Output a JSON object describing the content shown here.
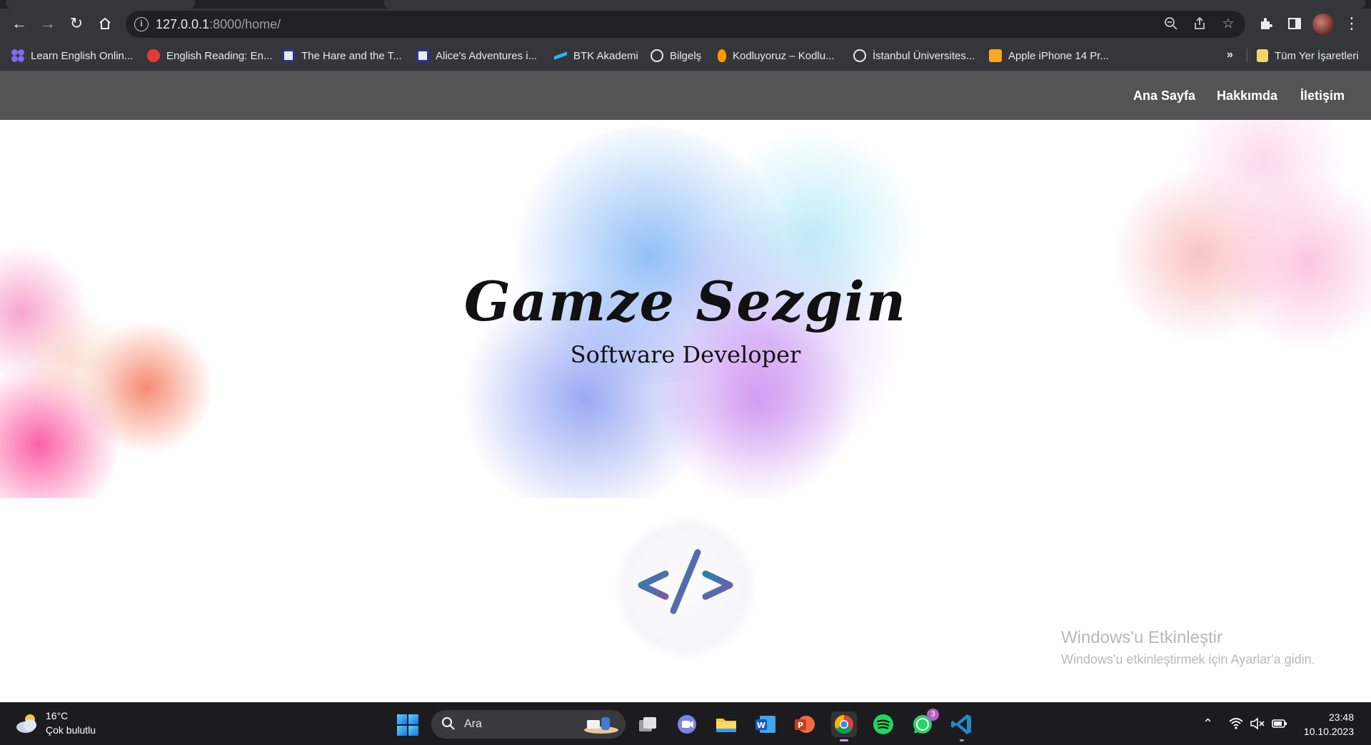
{
  "browser": {
    "url_host": "127.0.0.1",
    "url_path": ":8000/home/",
    "bookmarks": [
      {
        "label": "Learn English Onlin...",
        "icon": "grid-dots-icon",
        "color": "#5b5bd6"
      },
      {
        "label": "English Reading: En...",
        "icon": "chat-bubble-icon",
        "color": "#e53935"
      },
      {
        "label": "The Hare and the T...",
        "icon": "book-icon",
        "color": "#283593"
      },
      {
        "label": "Alice's Adventures i...",
        "icon": "book-icon",
        "color": "#283593"
      },
      {
        "label": "BTK Akademi",
        "icon": "btk-icon",
        "color": "#29b6f6"
      },
      {
        "label": "Bilgelş",
        "icon": "globe-icon",
        "color": "#e8eaed"
      },
      {
        "label": "Kodluyoruz – Kodlu...",
        "icon": "rocket-icon",
        "color": "#ff9800"
      },
      {
        "label": "İstanbul Üniversites...",
        "icon": "globe-icon",
        "color": "#e8eaed"
      },
      {
        "label": "Apple iPhone 14 Pr...",
        "icon": "store-icon",
        "color": "#f9a825"
      }
    ],
    "bookmarks_more": "»",
    "all_bookmarks": "Tüm Yer İşaretleri"
  },
  "nav": {
    "home": "Ana Sayfa",
    "about": "Hakkımda",
    "contact": "İletişim"
  },
  "hero": {
    "name": "Gamze Sezgin",
    "role": "Software Developer"
  },
  "watermark": {
    "title": "Windows'u Etkinleştir",
    "subtitle": "Windows'u etkinleştirmek için Ayarlar'a gidin."
  },
  "taskbar": {
    "temperature": "16°C",
    "condition": "Çok bulutlu",
    "search_placeholder": "Ara",
    "whatsapp_badge": "3",
    "time": "23:48",
    "date": "10.10.2023"
  },
  "colors": {
    "navbar": "#545454",
    "browser_chrome": "#35363a",
    "taskbar": "#1c1c1f",
    "code_logo_blue": "#2a7fb0",
    "code_logo_purple": "#7a5aa6"
  }
}
